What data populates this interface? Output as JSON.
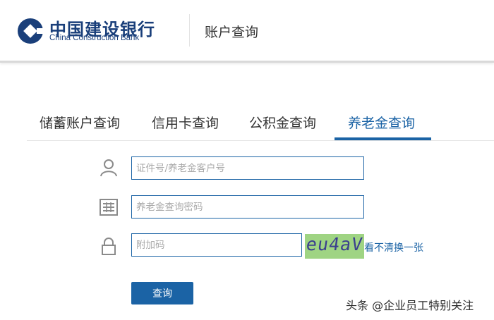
{
  "header": {
    "logo_cn": "中国建设银行",
    "logo_en": "China Construction Bank",
    "title": "账户查询"
  },
  "tabs": [
    {
      "label": "储蓄账户查询",
      "active": false
    },
    {
      "label": "信用卡查询",
      "active": false
    },
    {
      "label": "公积金查询",
      "active": false
    },
    {
      "label": "养老金查询",
      "active": true
    }
  ],
  "form": {
    "id_field": {
      "placeholder": "证件号/养老金客户号",
      "value": "",
      "icon": "user-icon"
    },
    "password_field": {
      "placeholder": "养老金查询密码",
      "value": "",
      "icon": "keypad-icon"
    },
    "captcha_field": {
      "placeholder": "附加码",
      "value": "",
      "icon": "lock-icon"
    },
    "captcha_text": "eu4aV",
    "refresh_label": "看不清换一张",
    "submit_label": "查询"
  },
  "watermark": "头条 @企业员工特别关注",
  "colors": {
    "brand_blue": "#1b63a5",
    "logo_blue": "#1a3f7a",
    "captcha_bg": "#9fd483"
  }
}
